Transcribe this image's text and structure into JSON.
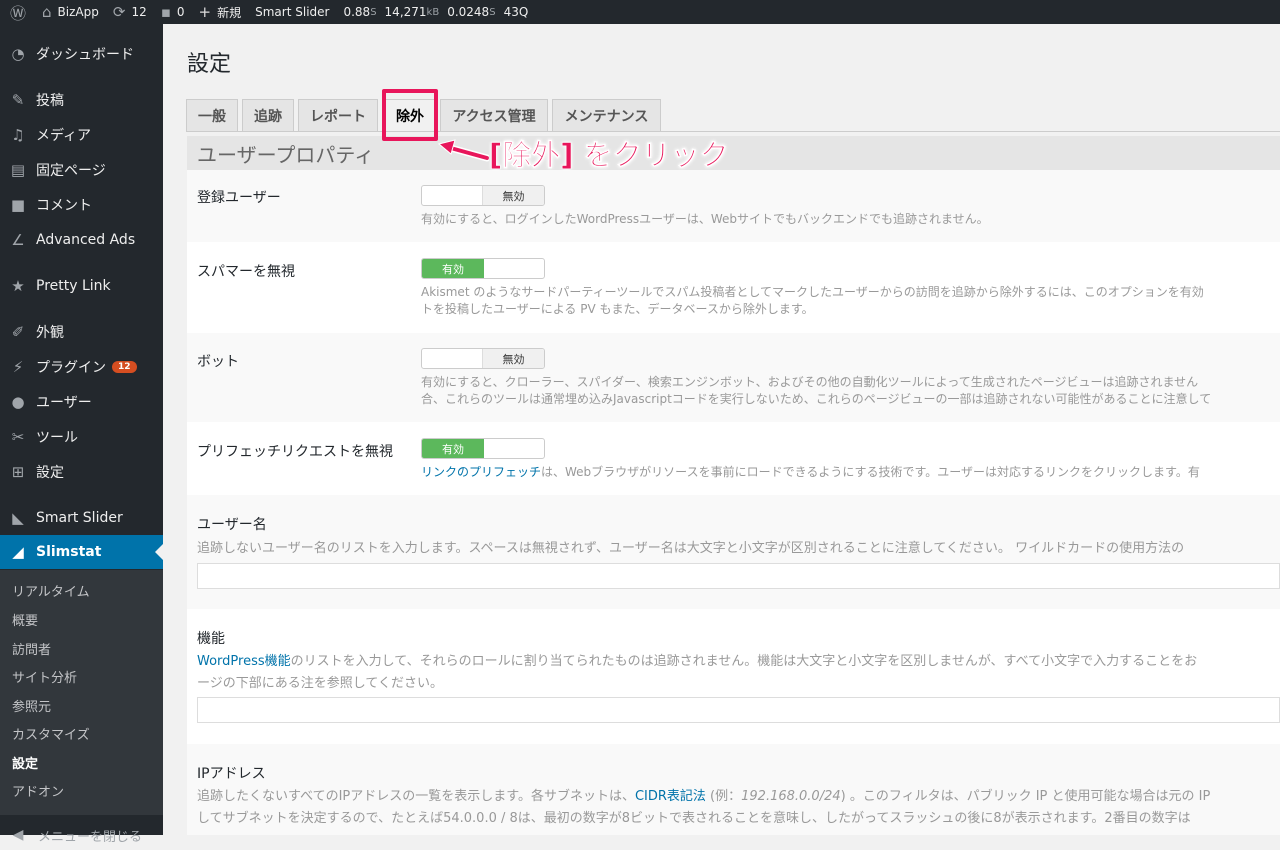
{
  "adminbar": {
    "site": "BizApp",
    "updates": "12",
    "comments": "0",
    "new_label": "新規",
    "plugin": "Smart Slider",
    "stat_time": "0.88",
    "stat_time_unit": "S",
    "stat_mem": "14,271",
    "stat_mem_unit": "kB",
    "stat_q_time": "0.0248",
    "stat_q_unit": "S",
    "stat_queries": "43Q"
  },
  "sidebar": {
    "items": [
      {
        "label": "ダッシュボード",
        "icon": "dashboard-icon"
      },
      {
        "label": "投稿",
        "icon": "pin-icon"
      },
      {
        "label": "メディア",
        "icon": "media-icon"
      },
      {
        "label": "固定ページ",
        "icon": "page-icon"
      },
      {
        "label": "コメント",
        "icon": "comment-icon"
      },
      {
        "label": "Advanced Ads",
        "icon": "chart-icon"
      },
      {
        "label": "Pretty Link",
        "icon": "star-icon"
      },
      {
        "label": "外観",
        "icon": "brush-icon"
      },
      {
        "label": "プラグイン",
        "icon": "plugin-icon",
        "badge": "12"
      },
      {
        "label": "ユーザー",
        "icon": "user-icon"
      },
      {
        "label": "ツール",
        "icon": "wrench-icon"
      },
      {
        "label": "設定",
        "icon": "settings-icon"
      },
      {
        "label": "Smart Slider",
        "icon": "slider-icon"
      },
      {
        "label": "Slimstat",
        "icon": "stats-icon"
      }
    ],
    "submenu": [
      "リアルタイム",
      "概要",
      "訪問者",
      "サイト分析",
      "参照元",
      "カスタマイズ",
      "設定",
      "アドオン"
    ],
    "collapse_label": "メニューを閉じる"
  },
  "page": {
    "title": "設定",
    "tabs": [
      "一般",
      "追跡",
      "レポート",
      "除外",
      "アクセス管理",
      "メンテナンス"
    ],
    "annotation": "[除外] をクリック",
    "section_header": "ユーザープロパティ"
  },
  "settings": {
    "registered_users": {
      "label": "登録ユーザー",
      "toggle": "無効",
      "desc": "有効にすると、ログインしたWordPressユーザーは、Webサイトでもバックエンドでも追跡されません。"
    },
    "ignore_spammers": {
      "label": "スパマーを無視",
      "toggle": "有効",
      "desc1": "Akismet のようなサードパーティーツールでスパム投稿者としてマークしたユーザーからの訪問を追跡から除外するには、このオプションを有効",
      "desc2": "トを投稿したユーザーによる PV もまた、データベースから除外します。"
    },
    "bots": {
      "label": "ボット",
      "toggle": "無効",
      "desc1": "有効にすると、クローラー、スパイダー、検索エンジンボット、およびその他の自動化ツールによって生成されたページビューは追跡されません",
      "desc2": "合、これらのツールは通常埋め込みJavascriptコードを実行しないため、これらのページビューの一部は追跡されない可能性があることに注意して"
    },
    "prefetch": {
      "label": "プリフェッチリクエストを無視",
      "toggle": "有効",
      "link": "リンクのプリフェッチ",
      "desc": "は、Webブラウザがリソースを事前にロードできるようにする技術です。ユーザーは対応するリンクをクリックします。有"
    },
    "usernames": {
      "label": "ユーザー名",
      "desc": "追跡しないユーザー名のリストを入力します。スペースは無視されず、ユーザー名は大文字と小文字が区別されることに注意してください。 ワイルドカードの使用方法の"
    },
    "capabilities": {
      "label": "機能",
      "link": "WordPress機能",
      "desc1": "のリストを入力して、それらのロールに割り当てられたものは追跡されません。機能は大文字と小文字を区別しませんが、すべて小文字で入力することをお",
      "desc2": "ージの下部にある注を参照してください。"
    },
    "ip": {
      "label": "IPアドレス",
      "desc1a": "追跡したくないすべてのIPアドレスの一覧を表示します。各サブネットは、",
      "link": "CIDR表記法",
      "desc1b": " (例：",
      "example": "192.168.0.0/24",
      "desc1c": ") 。このフィルタは、パブリック IP と使用可能な場合は元の IP",
      "desc2": "してサブネットを決定するので、たとえば54.0.0.0 / 8は、最初の数字が8ビットで表されることを意味し、したがってスラッシュの後に8が表示されます。2番目の数字は"
    }
  },
  "colors": {
    "accent": "#0073aa",
    "annotation": "#e8165b",
    "toggle_on": "#5cb85c"
  }
}
